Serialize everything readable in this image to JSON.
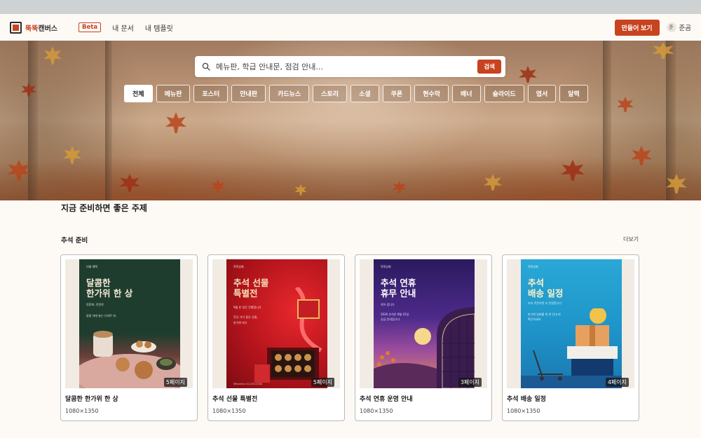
{
  "header": {
    "logo_accent": "뚝뚝",
    "logo_rest": "캔버스",
    "beta": "Beta",
    "nav": [
      "내 문서",
      "내 템플릿"
    ],
    "make_button": "만들어 보기",
    "user_initial": "준",
    "user_name": "준곰"
  },
  "search": {
    "placeholder": "메뉴판, 학급 안내문, 점검 안내...",
    "button": "검색"
  },
  "categories": [
    "전체",
    "메뉴판",
    "포스터",
    "안내판",
    "카드뉴스",
    "스토리",
    "소셜",
    "쿠폰",
    "현수막",
    "배너",
    "슬라이드",
    "엽서",
    "달력"
  ],
  "active_category": "전체",
  "section": {
    "title": "지금 준비하면 좋은 주제",
    "subtitle": "추석 준비",
    "more": "더보기"
  },
  "cards": [
    {
      "title": "달콤한 한가위 한 상",
      "size": "1080×1350",
      "pages": "5페이지",
      "poster_brand": "더채 체택",
      "poster_heading_1": "달콤한",
      "poster_heading_2": "한가위 한 상",
      "poster_line_1": "연휴에, 인연의",
      "poster_line_2": "달빛 아래 놓는 디저트 바."
    },
    {
      "title": "추석 선물 특별전",
      "size": "1080×1350",
      "pages": "5페이지",
      "poster_brand": "뚝뚝상회",
      "poster_heading_1": "추석 선물",
      "poster_heading_2": "특별전",
      "poster_line_1": "9월 한 일간 진행합니다",
      "poster_line_2": "전국 가기 좋은 선물,",
      "poster_line_3": "한가위 마다",
      "poster_foot": "@ttukttuk    02-000-0000"
    },
    {
      "title": "추석 연휴 운영 안내",
      "size": "1080×1350",
      "pages": "3페이지",
      "poster_brand": "뚝뚝상회",
      "poster_heading_1": "추석 연휴",
      "poster_heading_2": "휴무 안내",
      "poster_line_1": "쉬어 갑니다",
      "poster_line_2": "2026 추석은 9월 25일",
      "poster_line_3": "공급 안내입니다."
    },
    {
      "title": "추석 배송 일정",
      "size": "1080×1350",
      "pages": "4페이지",
      "poster_brand": "뚝뚝상회",
      "poster_heading_1": "추석",
      "poster_heading_2": "배송 일정",
      "poster_line_1": "미리 주문하면 더 안정합니다",
      "poster_line_2": "한가위 날짜를 위 한 안내 바",
      "poster_line_3": "확인하세요"
    }
  ],
  "colors": {
    "accent": "#c8431f",
    "background": "#fdfaf6"
  }
}
